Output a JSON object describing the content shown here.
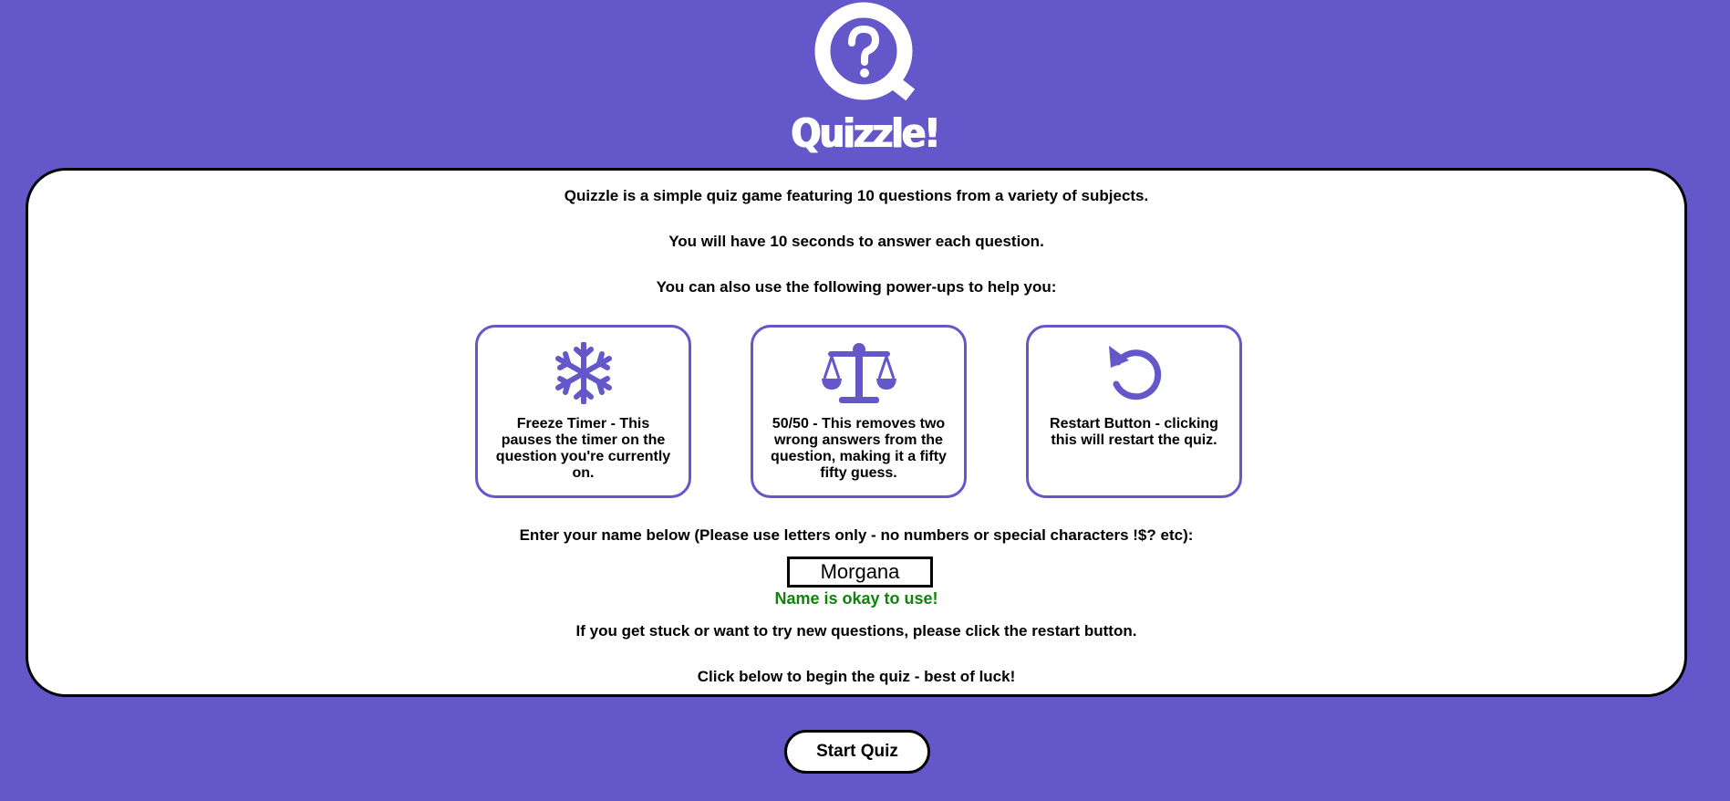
{
  "app": {
    "title": "Quizzle!"
  },
  "colors": {
    "accent": "#6457c9",
    "valid": "#12820f"
  },
  "intro": {
    "line1": "Quizzle is a simple quiz game featuring 10 questions from a variety of subjects.",
    "line2": "You will have 10 seconds to answer each question.",
    "line3": "You can also use the following power-ups to help you:"
  },
  "powerups": [
    {
      "icon": "snowflake-icon",
      "text": "Freeze Timer - This pauses the timer on the question you're currently on."
    },
    {
      "icon": "scales-icon",
      "text": "50/50 - This removes two wrong answers from the question, making it a fifty fifty guess."
    },
    {
      "icon": "restart-icon",
      "text": "Restart Button - clicking this will restart the quiz."
    }
  ],
  "name": {
    "prompt": "Enter your name below (Please use letters only - no numbers or special characters !$? etc):",
    "value": "Morgana",
    "validation": "Name is okay to use!"
  },
  "help_text": "If you get stuck or want to try new questions, please click the restart button.",
  "begin_text": "Click below to begin the quiz - best of luck!",
  "start_button": "Start Quiz"
}
